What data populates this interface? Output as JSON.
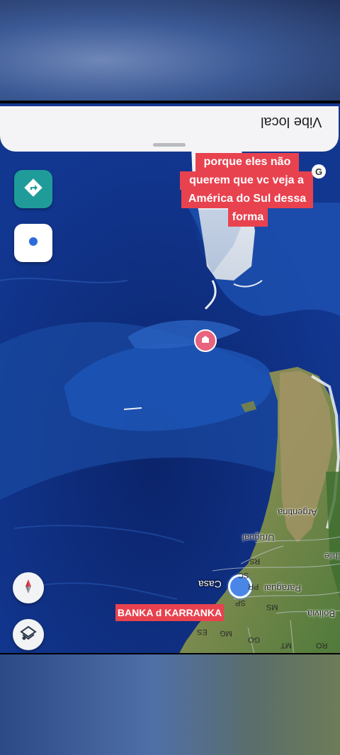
{
  "sheet": {
    "title": "Vibe local"
  },
  "captions": {
    "line1": "porque eles não",
    "line2": "querem que vc veja a",
    "line3": "América do Sul dessa",
    "line4": "forma"
  },
  "watermark": "BANKA d KARRANKA",
  "map_labels": {
    "casa": "Casa",
    "argentina": "Argentina",
    "uruguai": "Uruguai",
    "paraguai": "Paraguai",
    "bolivia": "Bolívia",
    "chile": "Chile",
    "corner_badge": "G"
  },
  "state_codes": [
    "RS",
    "SC",
    "PR",
    "SP",
    "MS",
    "MG",
    "GO",
    "ES",
    "MT",
    "RO"
  ],
  "icons": {
    "directions": "directions-icon",
    "location": "my-location-icon",
    "compass": "compass-icon",
    "layers": "layers-icon",
    "favorite_pin": "home-pin-icon"
  }
}
